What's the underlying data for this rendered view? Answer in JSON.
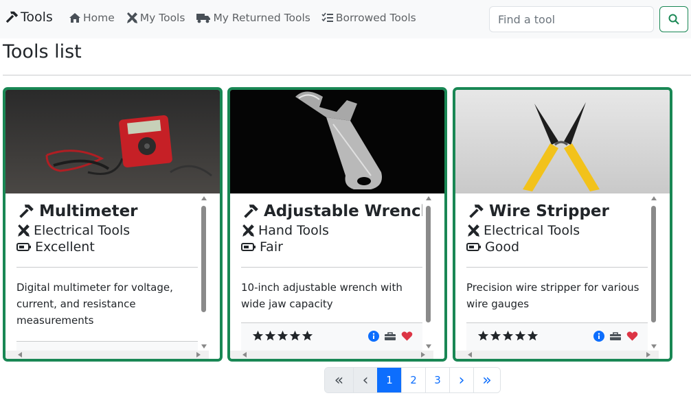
{
  "navbar": {
    "brand": "Tools",
    "links": [
      {
        "label": "Home",
        "icon": "home-icon"
      },
      {
        "label": "My Tools",
        "icon": "tools-icon"
      },
      {
        "label": "My Returned Tools",
        "icon": "truck-icon"
      },
      {
        "label": "Borrowed Tools",
        "icon": "list-check-icon"
      }
    ],
    "search": {
      "placeholder": "Find a tool",
      "value": ""
    }
  },
  "page": {
    "title": "Tools list"
  },
  "tools": [
    {
      "name": "Multimeter",
      "category": "Electrical Tools",
      "condition": "Excellent",
      "description": "Digital multimeter for voltage, current, and resistance measurements",
      "rating": 5
    },
    {
      "name": "Adjustable Wrench",
      "category": "Hand Tools",
      "condition": "Fair",
      "description": "10-inch adjustable wrench with wide jaw capacity",
      "rating": 5
    },
    {
      "name": "Wire Stripper",
      "category": "Electrical Tools",
      "condition": "Good",
      "description": "Precision wire stripper for various wire gauges",
      "rating": 5
    }
  ],
  "pagination": {
    "first": "«",
    "prev": "‹",
    "pages": [
      "1",
      "2",
      "3"
    ],
    "active": "1",
    "next": "›",
    "last": "»"
  },
  "colors": {
    "accent": "#198754",
    "primary": "#0d6efd",
    "heart": "#dc3545"
  }
}
